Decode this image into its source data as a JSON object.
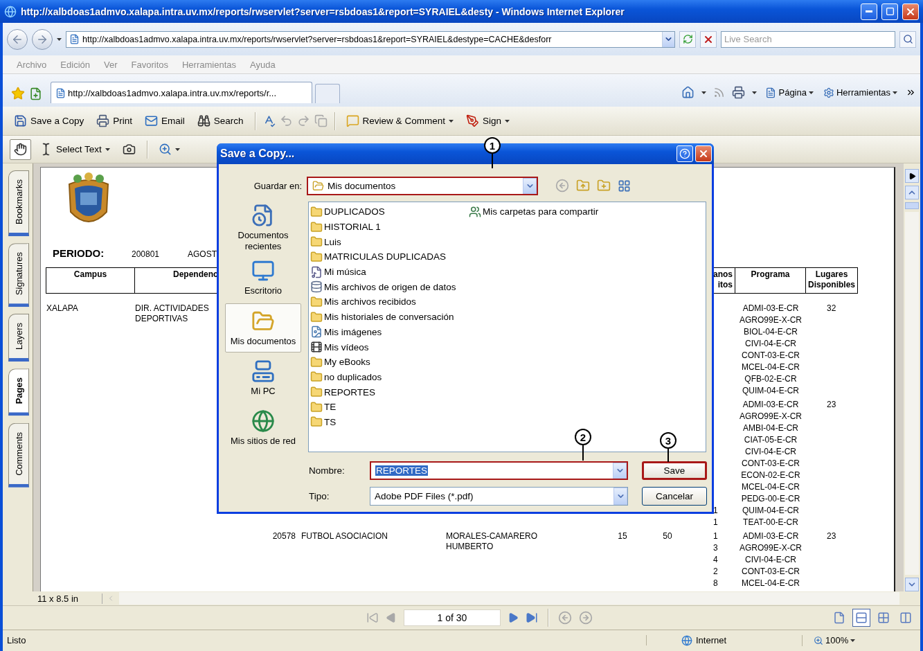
{
  "window": {
    "title": "http://xalbdoas1admvo.xalapa.intra.uv.mx/reports/rwservlet?server=rsbdoas1&report=SYRAIEL&desty - Windows Internet Explorer"
  },
  "address_bar": {
    "url": "http://xalbdoas1admvo.xalapa.intra.uv.mx/reports/rwservlet?server=rsbdoas1&report=SYRAIEL&destype=CACHE&desforr",
    "search_placeholder": "Live Search"
  },
  "menu": [
    "Archivo",
    "Edición",
    "Ver",
    "Favoritos",
    "Herramientas",
    "Ayuda"
  ],
  "browser_tabs": [
    {
      "label": "http://xalbdoas1admvo.xalapa.intra.uv.mx/reports/r...",
      "selected": true
    }
  ],
  "command_bar": [
    {
      "kind": "page",
      "label": "Página"
    },
    {
      "kind": "tools",
      "label": "Herramientas"
    }
  ],
  "acrobat_toolbar": [
    [
      {
        "kind": "save",
        "label": "Save a Copy"
      },
      {
        "kind": "print",
        "label": "Print"
      },
      {
        "kind": "email",
        "label": "Email"
      },
      {
        "kind": "search",
        "label": "Search"
      }
    ],
    [
      {
        "kind": "spell"
      },
      {
        "kind": "undo"
      },
      {
        "kind": "redo"
      },
      {
        "kind": "copy"
      }
    ],
    [
      {
        "kind": "review",
        "label": "Review & Comment",
        "dropdown": true
      },
      {
        "kind": "sign",
        "label": "Sign",
        "dropdown": true
      }
    ]
  ],
  "tools_toolbar": [
    {
      "kind": "hand",
      "selected": true
    },
    {
      "kind": "select",
      "label": "Select Text",
      "dropdown": true,
      "selected": false
    },
    {
      "kind": "snapshot",
      "selected": false
    },
    {
      "kind": "zoom",
      "dropdown": true,
      "selected": false
    }
  ],
  "nav_panel_tabs": [
    {
      "label": "Bookmarks",
      "selected": false
    },
    {
      "label": "Signatures",
      "selected": false
    },
    {
      "label": "Layers",
      "selected": false
    },
    {
      "label": "Pages",
      "selected": true
    },
    {
      "label": "Comments",
      "selected": false
    }
  ],
  "document": {
    "periodo_label": "PERIODO:",
    "periodo_value": "200801",
    "periodo_text": "AGOST",
    "columns": [
      "Campus",
      "Dependenc",
      "anos\nitos",
      "Programa",
      "Lugares Disponibles"
    ],
    "groups": [
      {
        "campus": "XALAPA",
        "dependencia": "DIR. ACTIVIDADES DEPORTIVAS",
        "lugares": "32",
        "programas": [
          {
            "code": "ADMI-03-E-CR"
          },
          {
            "code": "AGRO99E-X-CR"
          },
          {
            "code": "BIOL-04-E-CR"
          },
          {
            "code": "CIVI-04-E-CR"
          },
          {
            "code": "CONT-03-E-CR"
          },
          {
            "code": "MCEL-04-E-CR"
          },
          {
            "code": "QFB-02-E-CR"
          },
          {
            "code": "QUIM-04-E-CR"
          }
        ]
      },
      {
        "lugares": "23",
        "programas": [
          {
            "code": "ADMI-03-E-CR"
          },
          {
            "code": "AGRO99E-X-CR"
          },
          {
            "code": "AMBI-04-E-CR"
          },
          {
            "code": "CIAT-05-E-CR"
          },
          {
            "code": "CIVI-04-E-CR"
          },
          {
            "code": "CONT-03-E-CR"
          },
          {
            "code": "ECON-02-E-CR"
          },
          {
            "code": "MCEL-04-E-CR"
          },
          {
            "code": "PEDG-00-E-CR"
          },
          {
            "code": "QUIM-04-E-CR",
            "count": "1"
          },
          {
            "code": "TEAT-00-E-CR",
            "count": "1"
          }
        ]
      },
      {
        "column_3": "20578",
        "column_4": "FUTBOL ASOCIACION",
        "column_5": "MORALES-CAMARERO HUMBERTO",
        "column_6": "15",
        "column_7": "50",
        "lugares": "23",
        "programas": [
          {
            "code": "ADMI-03-E-CR",
            "count": "1"
          },
          {
            "code": "AGRO99E-X-CR",
            "count": "3"
          },
          {
            "code": "CIVI-04-E-CR",
            "count": "4"
          },
          {
            "code": "CONT-03-E-CR",
            "count": "2"
          },
          {
            "code": "MCEL-04-E-CR",
            "count": "8"
          }
        ]
      }
    ]
  },
  "page_size": "11 x 8.5 in",
  "page_nav": {
    "page": "1 of 30"
  },
  "view_modes": [
    {
      "kind": "single",
      "selected": false
    },
    {
      "kind": "continuous",
      "selected": true
    },
    {
      "kind": "continuous_facing",
      "selected": false
    },
    {
      "kind": "facing",
      "selected": false
    }
  ],
  "status_bar": {
    "text": "Listo",
    "zone": "Internet",
    "zoom": "100%"
  },
  "dialog": {
    "title": "Save a Copy...",
    "save_in": {
      "label": "Guardar en:",
      "value": "Mis documentos",
      "highlighted": true
    },
    "places": [
      {
        "kind": "recent",
        "label": "Documentos recientes",
        "selected": false
      },
      {
        "kind": "desktop",
        "label": "Escritorio",
        "selected": false
      },
      {
        "kind": "documents",
        "label": "Mis documentos",
        "selected": true
      },
      {
        "kind": "computer",
        "label": "Mi PC",
        "selected": false
      },
      {
        "kind": "network",
        "label": "Mis sitios de red",
        "selected": false
      }
    ],
    "files": [
      {
        "kind": "folder",
        "name": "DUPLICADOS"
      },
      {
        "kind": "folder",
        "name": "HISTORIAL 1"
      },
      {
        "kind": "folder",
        "name": "Luis"
      },
      {
        "kind": "folder",
        "name": "MATRICULAS DUPLICADAS"
      },
      {
        "kind": "music",
        "name": "Mi música"
      },
      {
        "kind": "data",
        "name": "Mis archivos de origen de datos"
      },
      {
        "kind": "folder",
        "name": "Mis archivos recibidos"
      },
      {
        "kind": "folder",
        "name": "Mis historiales de conversación"
      },
      {
        "kind": "images",
        "name": "Mis imágenes"
      },
      {
        "kind": "video",
        "name": "Mis vídeos"
      },
      {
        "kind": "folder",
        "name": "My eBooks"
      },
      {
        "kind": "folder",
        "name": "no duplicados"
      },
      {
        "kind": "folder",
        "name": "REPORTES"
      },
      {
        "kind": "folder",
        "name": "TE"
      },
      {
        "kind": "folder",
        "name": "TS"
      },
      {
        "kind": "shared",
        "name": "Mis carpetas para compartir"
      }
    ],
    "file_name": {
      "label": "Nombre:",
      "value": "REPORTES",
      "highlighted": true,
      "value_selected": true
    },
    "file_type": {
      "label": "Tipo:",
      "value": "Adobe PDF Files (*.pdf)"
    },
    "buttons": [
      {
        "label": "Save",
        "highlighted": true
      },
      {
        "label": "Cancelar",
        "highlighted": false
      }
    ],
    "callouts": [
      "1",
      "2",
      "3"
    ]
  }
}
